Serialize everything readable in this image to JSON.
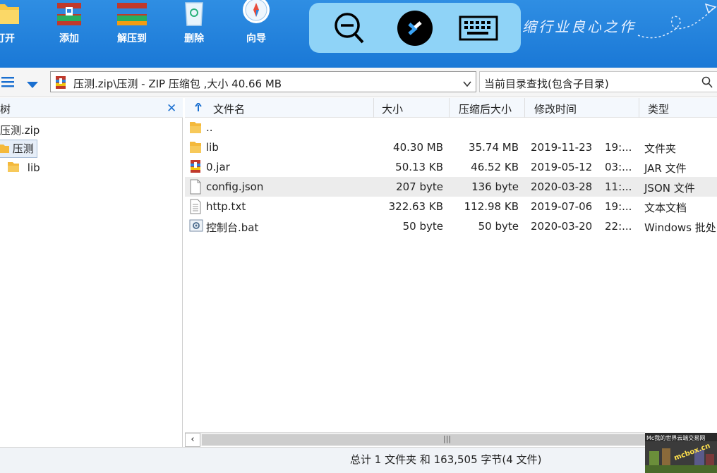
{
  "toolbar": {
    "buttons": [
      {
        "label": "打开",
        "icon": "open-icon"
      },
      {
        "label": "添加",
        "icon": "add-archive-icon"
      },
      {
        "label": "解压到",
        "icon": "extract-icon"
      },
      {
        "label": "删除",
        "icon": "recycle-delete-icon"
      },
      {
        "label": "向导",
        "icon": "compass-wizard-icon"
      }
    ],
    "slogan": "缩行业良心之作"
  },
  "address": {
    "path": "压测.zip\\压测 - ZIP 压缩包 ,大小 40.66 MB",
    "search_placeholder": "当前目录查找(包含子目录)"
  },
  "tree": {
    "title": "树",
    "items": [
      {
        "label": "压测.zip",
        "level": 0
      },
      {
        "label": "压测",
        "level": 1,
        "selected": true
      },
      {
        "label": "lib",
        "level": 2
      }
    ]
  },
  "list": {
    "columns": [
      "文件名",
      "大小",
      "压缩后大小",
      "修改时间",
      "类型"
    ],
    "rows": [
      {
        "name": "..",
        "size": "",
        "packed": "",
        "date": "",
        "time": "",
        "type": "",
        "icon": "folder-icon"
      },
      {
        "name": "lib",
        "size": "40.30 MB",
        "packed": "35.74 MB",
        "date": "2019-11-23",
        "time": "19:...",
        "type": "文件夹",
        "icon": "folder-icon"
      },
      {
        "name": "0.jar",
        "size": "50.13 KB",
        "packed": "46.52 KB",
        "date": "2019-05-12",
        "time": "03:...",
        "type": "JAR 文件",
        "icon": "archive-icon"
      },
      {
        "name": "config.json",
        "size": "207 byte",
        "packed": "136 byte",
        "date": "2020-03-28",
        "time": "11:...",
        "type": "JSON 文件",
        "icon": "blank-file-icon"
      },
      {
        "name": "http.txt",
        "size": "322.63 KB",
        "packed": "112.98 KB",
        "date": "2019-07-06",
        "time": "19:...",
        "type": "文本文档",
        "icon": "text-file-icon"
      },
      {
        "name": "控制台.bat",
        "size": "50 byte",
        "packed": "50 byte",
        "date": "2020-03-20",
        "time": "22:...",
        "type": "Windows 批处",
        "icon": "batch-file-icon"
      }
    ]
  },
  "status": {
    "text": "总计 1 文件夹 和 163,505 字节(4 文件)"
  },
  "watermark": {
    "top": "Mc我的世界云端交易网",
    "mid": "mcbox.cn"
  },
  "colors": {
    "toolbar": "#1f80dd",
    "remote_bar": "#8fd3f7",
    "selection": "#ececec"
  }
}
